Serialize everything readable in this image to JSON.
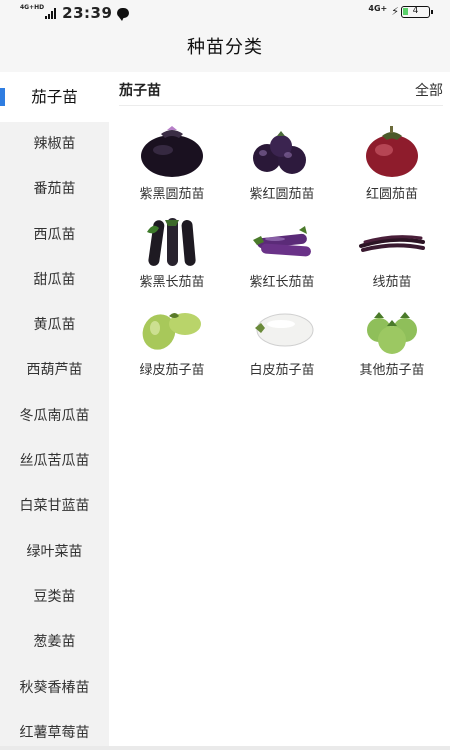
{
  "status_bar": {
    "network_label": "4G+HD",
    "time": "23:39",
    "right_network": "4G+",
    "battery_level": "4",
    "icons": [
      "signal-icon",
      "message-icon",
      "charging-icon",
      "battery-icon"
    ]
  },
  "header": {
    "title": "种苗分类"
  },
  "sidebar": {
    "active_index": 0,
    "accent_color": "#2f7de1",
    "items": [
      {
        "label": "茄子苗"
      },
      {
        "label": "辣椒苗"
      },
      {
        "label": "番茄苗"
      },
      {
        "label": "西瓜苗"
      },
      {
        "label": "甜瓜苗"
      },
      {
        "label": "黄瓜苗"
      },
      {
        "label": "西葫芦苗"
      },
      {
        "label": "冬瓜南瓜苗"
      },
      {
        "label": "丝瓜苦瓜苗"
      },
      {
        "label": "白菜甘蓝苗"
      },
      {
        "label": "绿叶菜苗"
      },
      {
        "label": "豆类苗"
      },
      {
        "label": "葱姜苗"
      },
      {
        "label": "秋葵香椿苗"
      },
      {
        "label": "红薯草莓苗"
      }
    ]
  },
  "main": {
    "section_title": "茄子苗",
    "all_label": "全部",
    "products": [
      {
        "label": "紫黑圆茄苗",
        "image": "purple-black-round-eggplant"
      },
      {
        "label": "紫红圆茄苗",
        "image": "purple-red-round-eggplant"
      },
      {
        "label": "红圆茄苗",
        "image": "red-round-eggplant"
      },
      {
        "label": "紫黑长茄苗",
        "image": "purple-black-long-eggplant"
      },
      {
        "label": "紫红长茄苗",
        "image": "purple-red-long-eggplant"
      },
      {
        "label": "线茄苗",
        "image": "thin-line-eggplant"
      },
      {
        "label": "绿皮茄子苗",
        "image": "green-eggplant"
      },
      {
        "label": "白皮茄子苗",
        "image": "white-eggplant"
      },
      {
        "label": "其他茄子苗",
        "image": "other-eggplant"
      }
    ]
  }
}
